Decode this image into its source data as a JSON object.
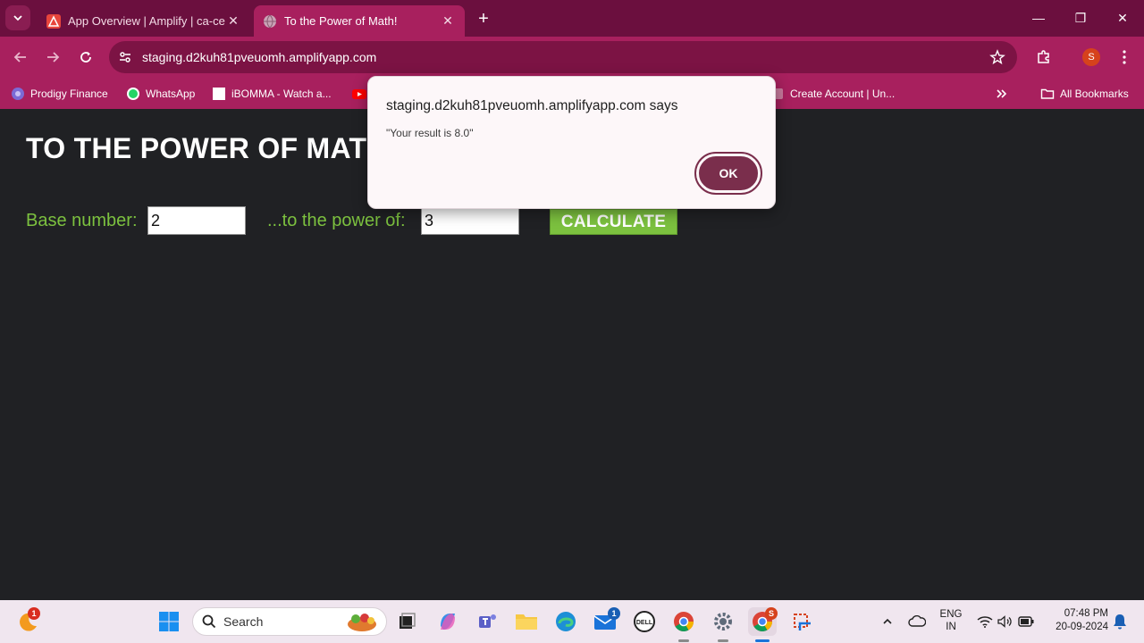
{
  "browser": {
    "tabs": [
      {
        "title": "App Overview | Amplify | ca-cen",
        "favicon": "amplify-icon",
        "active": false
      },
      {
        "title": "To the Power of Math!",
        "favicon": "globe-icon",
        "active": true
      }
    ],
    "new_tab": "+",
    "url": "staging.d2kuh81pveuomh.amplifyapp.com",
    "profile_initial": "S",
    "window_controls": {
      "minimize": "—",
      "restore": "❐",
      "close": "✕"
    }
  },
  "bookmarks": {
    "items": [
      {
        "label": "Prodigy Finance",
        "icon": "prodigy-icon"
      },
      {
        "label": "WhatsApp",
        "icon": "whatsapp-icon"
      },
      {
        "label": "iBOMMA - Watch a...",
        "icon": "page-icon"
      },
      {
        "label": "Create Account | Un...",
        "icon": "account-icon"
      }
    ],
    "all_bookmarks": "All Bookmarks"
  },
  "page": {
    "title": "TO THE POWER OF MATH",
    "base_label": "Base number:",
    "base_value": "2",
    "power_label": "...to the power of:",
    "power_value": "3",
    "calculate": "CALCULATE"
  },
  "dialog": {
    "title": "staging.d2kuh81pveuomh.amplifyapp.com says",
    "message": "\"Your result is 8.0\"",
    "ok": "OK"
  },
  "taskbar": {
    "search_placeholder": "Search",
    "weather_badge": "1",
    "mail_badge": "1",
    "chrome_badge": "S",
    "language": "ENG",
    "region": "IN",
    "time": "07:48 PM",
    "date": "20-09-2024"
  },
  "colors": {
    "frame": "#6b0f3e",
    "toolbar": "#a8205e",
    "page_bg": "#202124",
    "accent_green": "#7cc13f",
    "ok_button": "#7a2e4c"
  }
}
